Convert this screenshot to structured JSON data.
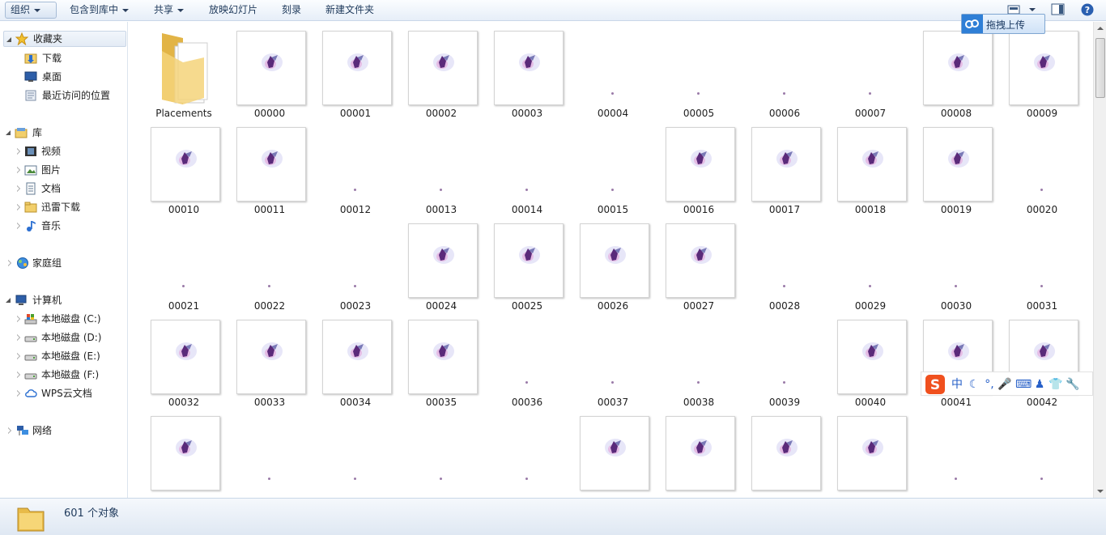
{
  "toolbar": {
    "organize": "组织",
    "include_in_library": "包含到库中",
    "share": "共享",
    "slideshow": "放映幻灯片",
    "burn": "刻录",
    "new_folder": "新建文件夹"
  },
  "upload_button": {
    "label": "拖拽上传"
  },
  "nav": {
    "favorites": "收藏夹",
    "downloads": "下载",
    "desktop": "桌面",
    "recent": "最近访问的位置",
    "libraries": "库",
    "videos": "视频",
    "pictures": "图片",
    "documents": "文档",
    "xunlei": "迅雷下载",
    "music": "音乐",
    "homegroup": "家庭组",
    "computer": "计算机",
    "disk_c": "本地磁盘 (C:)",
    "disk_d": "本地磁盘 (D:)",
    "disk_e": "本地磁盘 (E:)",
    "disk_f": "本地磁盘 (F:)",
    "wps": "WPS云文档",
    "network": "网络"
  },
  "files": [
    {
      "name": "Placements",
      "kind": "folder"
    },
    {
      "name": "00000",
      "kind": "splat"
    },
    {
      "name": "00001",
      "kind": "splat"
    },
    {
      "name": "00002",
      "kind": "splat"
    },
    {
      "name": "00003",
      "kind": "splat"
    },
    {
      "name": "00004",
      "kind": "dot"
    },
    {
      "name": "00005",
      "kind": "dot"
    },
    {
      "name": "00006",
      "kind": "dot"
    },
    {
      "name": "00007",
      "kind": "dot"
    },
    {
      "name": "00008",
      "kind": "splat"
    },
    {
      "name": "00009",
      "kind": "splat"
    },
    {
      "name": "00010",
      "kind": "splat"
    },
    {
      "name": "00011",
      "kind": "splat"
    },
    {
      "name": "00012",
      "kind": "dot"
    },
    {
      "name": "00013",
      "kind": "dot"
    },
    {
      "name": "00014",
      "kind": "dot"
    },
    {
      "name": "00015",
      "kind": "dot"
    },
    {
      "name": "00016",
      "kind": "splat"
    },
    {
      "name": "00017",
      "kind": "splat"
    },
    {
      "name": "00018",
      "kind": "splat"
    },
    {
      "name": "00019",
      "kind": "splat"
    },
    {
      "name": "00020",
      "kind": "dot"
    },
    {
      "name": "00021",
      "kind": "dot"
    },
    {
      "name": "00022",
      "kind": "dot"
    },
    {
      "name": "00023",
      "kind": "dot"
    },
    {
      "name": "00024",
      "kind": "splat"
    },
    {
      "name": "00025",
      "kind": "splat"
    },
    {
      "name": "00026",
      "kind": "splat"
    },
    {
      "name": "00027",
      "kind": "splat"
    },
    {
      "name": "00028",
      "kind": "dot"
    },
    {
      "name": "00029",
      "kind": "dot"
    },
    {
      "name": "00030",
      "kind": "dot"
    },
    {
      "name": "00031",
      "kind": "dot"
    },
    {
      "name": "00032",
      "kind": "splat"
    },
    {
      "name": "00033",
      "kind": "splat"
    },
    {
      "name": "00034",
      "kind": "splat"
    },
    {
      "name": "00035",
      "kind": "splat"
    },
    {
      "name": "00036",
      "kind": "dot"
    },
    {
      "name": "00037",
      "kind": "dot"
    },
    {
      "name": "00038",
      "kind": "dot"
    },
    {
      "name": "00039",
      "kind": "dot"
    },
    {
      "name": "00040",
      "kind": "splat"
    },
    {
      "name": "00041",
      "kind": "splat"
    },
    {
      "name": "00042",
      "kind": "splat"
    },
    {
      "name": "",
      "kind": "splat"
    },
    {
      "name": "",
      "kind": "dot"
    },
    {
      "name": "",
      "kind": "dot"
    },
    {
      "name": "",
      "kind": "dot"
    },
    {
      "name": "",
      "kind": "dot"
    },
    {
      "name": "",
      "kind": "splat"
    },
    {
      "name": "",
      "kind": "splat"
    },
    {
      "name": "",
      "kind": "splat"
    },
    {
      "name": "",
      "kind": "splat"
    },
    {
      "name": "",
      "kind": "dot"
    },
    {
      "name": "",
      "kind": "dot"
    }
  ],
  "status": {
    "count": "601 个对象"
  },
  "ime": {
    "mode": "中"
  },
  "colors": {
    "accent": "#2f7fd6",
    "selection": "#e3ebf5",
    "splat": "#5a2a7a"
  }
}
